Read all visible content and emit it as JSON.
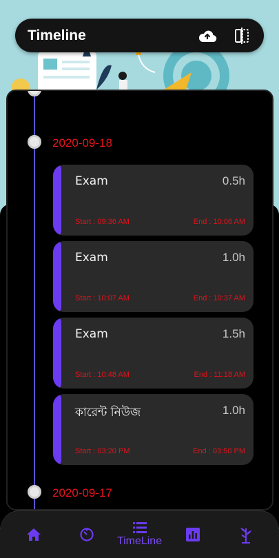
{
  "app_bar": {
    "title": "Timeline",
    "icons": [
      "cloud-upload-icon",
      "compare-icon"
    ]
  },
  "timeline": {
    "groups": [
      {
        "date": "2020-09-18",
        "entries": [
          {
            "title": "Exam",
            "duration": "0.5h",
            "start": "Start : 09:36 AM",
            "end": "End : 10:06 AM"
          },
          {
            "title": "Exam",
            "duration": "1.0h",
            "start": "Start : 10:07 AM",
            "end": "End : 10:37 AM"
          },
          {
            "title": "Exam",
            "duration": "1.5h",
            "start": "Start : 10:48 AM",
            "end": "End : 11:18 AM"
          },
          {
            "title": "কারেন্ট নিউজ",
            "duration": "1.0h",
            "start": "Start : 03:20 PM",
            "end": "End : 03:50 PM"
          }
        ]
      },
      {
        "date": "2020-09-17",
        "entries": []
      }
    ]
  },
  "bottom_nav": {
    "items": [
      {
        "icon": "home-icon"
      },
      {
        "icon": "timer-icon"
      },
      {
        "icon": "list-icon",
        "label": "TimeLine",
        "active": true
      },
      {
        "icon": "bar-chart-icon"
      },
      {
        "icon": "plant-icon"
      }
    ]
  },
  "colors": {
    "accent": "#6a3bf0",
    "date": "#e8141c",
    "card": "#2a2a2a",
    "background": "#000000"
  }
}
